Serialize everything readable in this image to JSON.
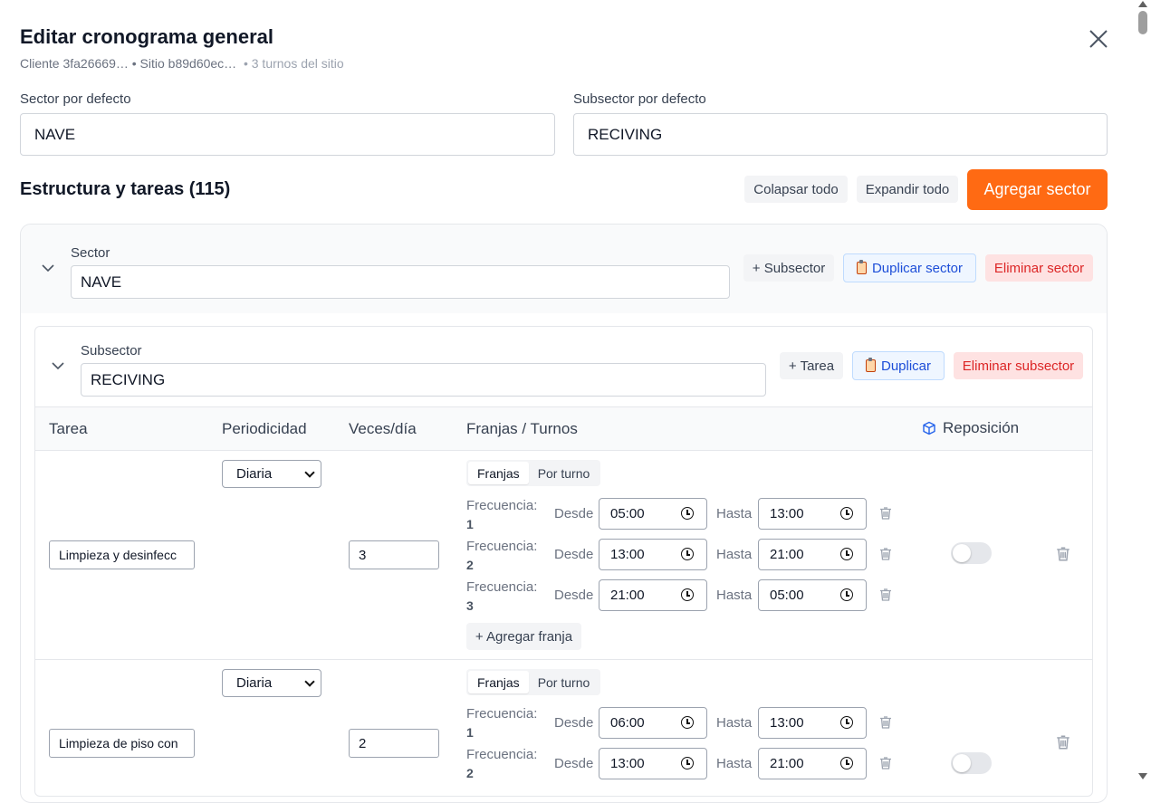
{
  "header": {
    "title": "Editar cronograma general",
    "client": "Cliente 3fa26669…",
    "site": "• Sitio b89d60ec…",
    "shifts": "• 3 turnos del sitio"
  },
  "defaults": {
    "sector_label": "Sector por defecto",
    "sector_value": "NAVE",
    "subsector_label": "Subsector por defecto",
    "subsector_value": "RECIVING"
  },
  "structure": {
    "title": "Estructura y tareas (115)",
    "collapse_all": "Colapsar todo",
    "expand_all": "Expandir todo",
    "add_sector": "Agregar sector"
  },
  "sector": {
    "label": "Sector",
    "value": "NAVE",
    "add_subsector": "+ Subsector",
    "duplicate": "Duplicar sector",
    "delete": "Eliminar sector"
  },
  "subsector": {
    "label": "Subsector",
    "value": "RECIVING",
    "add_task": "+ Tarea",
    "duplicate": "Duplicar",
    "delete": "Eliminar subsector"
  },
  "table": {
    "headers": {
      "task": "Tarea",
      "periodicity": "Periodicidad",
      "times": "Veces/día",
      "slots": "Franjas / Turnos",
      "replenish": "Reposición"
    },
    "mode_franjas": "Franjas",
    "mode_turno": "Por turno",
    "freq_label": "Frecuencia:",
    "from_label": "Desde",
    "to_label": "Hasta",
    "add_slot": "+ Agregar franja",
    "rows": [
      {
        "task": "Limpieza y desinfecc",
        "periodicity": "Diaria",
        "times": "3",
        "replenish_on": false,
        "slots": [
          {
            "n": "1",
            "from": "05:00",
            "to": "13:00"
          },
          {
            "n": "2",
            "from": "13:00",
            "to": "21:00"
          },
          {
            "n": "3",
            "from": "21:00",
            "to": "05:00"
          }
        ]
      },
      {
        "task": "Limpieza de piso con",
        "periodicity": "Diaria",
        "times": "2",
        "replenish_on": false,
        "slots": [
          {
            "n": "1",
            "from": "06:00",
            "to": "13:00"
          },
          {
            "n": "2",
            "from": "13:00",
            "to": "21:00"
          }
        ]
      }
    ]
  }
}
